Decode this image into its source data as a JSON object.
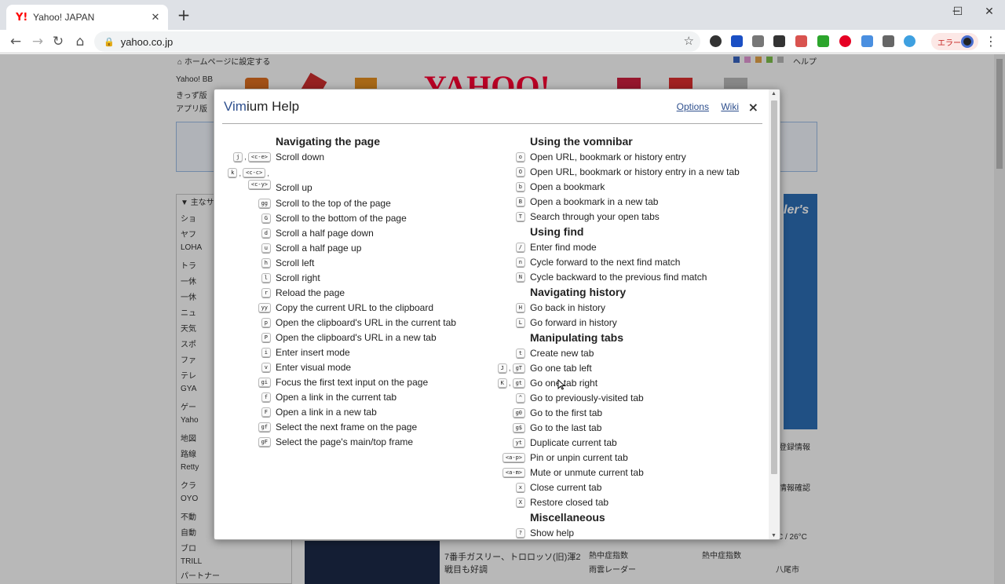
{
  "browser": {
    "tab_title": "Yahoo! JAPAN",
    "tab_favicon": "Y!",
    "new_tab": "+",
    "url": "yahoo.co.jp",
    "error_label": "エラー",
    "window": {
      "minimize": "─",
      "maximize": "☐",
      "close": "✕"
    }
  },
  "page_bg": {
    "home_link": "ホームページに設定する",
    "help": "ヘルプ",
    "left_links": [
      "Yahoo! BB",
      "きっず版",
      "アプリ版"
    ],
    "logo": "YAHOO!",
    "sidebar_header": "主なサ",
    "sidebar_items": [
      "ショ",
      "ヤフ",
      "LOHA",
      "トラ",
      "一休",
      "一休",
      "ニュ",
      "天気",
      "スポ",
      "ファ",
      "テレ",
      "GYA",
      "ゲー",
      "Yaho",
      "地図",
      "路線",
      "Retty",
      "クラ",
      "OYO",
      "不動",
      "自動",
      "ブロ",
      "TRILL",
      "パートナー"
    ],
    "ad_text": "ler's",
    "news_lines": [
      "7番手ガスリー、トロロッソ(旧)渾2",
      "戦目も好調"
    ],
    "weather": {
      "heat1": "熱中症指数",
      "heat2": "熱中症指数",
      "radar": "雨雲レーダー",
      "city": "八尾市",
      "temp": "C / 26°C",
      "login": "登録情報",
      "confirm": "情報確認"
    }
  },
  "modal": {
    "title_prefix": "Vim",
    "title_suffix": "ium Help",
    "options_link": "Options",
    "wiki_link": "Wiki",
    "close": "×",
    "left_sections": [
      {
        "title": "Navigating the page",
        "items": [
          {
            "keys": [
              "j",
              "<c-e>"
            ],
            "desc": "Scroll down"
          },
          {
            "keys": [
              "k",
              "<c-c>",
              "<c-y>"
            ],
            "desc": "Scroll up",
            "tall": true
          },
          {
            "keys": [
              "gg"
            ],
            "desc": "Scroll to the top of the page"
          },
          {
            "keys": [
              "G"
            ],
            "desc": "Scroll to the bottom of the page"
          },
          {
            "keys": [
              "d"
            ],
            "desc": "Scroll a half page down"
          },
          {
            "keys": [
              "u"
            ],
            "desc": "Scroll a half page up"
          },
          {
            "keys": [
              "h"
            ],
            "desc": "Scroll left"
          },
          {
            "keys": [
              "l"
            ],
            "desc": "Scroll right"
          },
          {
            "keys": [
              "r"
            ],
            "desc": "Reload the page"
          },
          {
            "keys": [
              "yy"
            ],
            "desc": "Copy the current URL to the clipboard"
          },
          {
            "keys": [
              "p"
            ],
            "desc": "Open the clipboard's URL in the current tab"
          },
          {
            "keys": [
              "P"
            ],
            "desc": "Open the clipboard's URL in a new tab"
          },
          {
            "keys": [
              "i"
            ],
            "desc": "Enter insert mode"
          },
          {
            "keys": [
              "v"
            ],
            "desc": "Enter visual mode"
          },
          {
            "keys": [
              "gi"
            ],
            "desc": "Focus the first text input on the page"
          },
          {
            "keys": [
              "f"
            ],
            "desc": "Open a link in the current tab"
          },
          {
            "keys": [
              "F"
            ],
            "desc": "Open a link in a new tab"
          },
          {
            "keys": [
              "gf"
            ],
            "desc": "Select the next frame on the page"
          },
          {
            "keys": [
              "gF"
            ],
            "desc": "Select the page's main/top frame"
          }
        ]
      }
    ],
    "right_sections": [
      {
        "title": "Using the vomnibar",
        "items": [
          {
            "keys": [
              "o"
            ],
            "desc": "Open URL, bookmark or history entry"
          },
          {
            "keys": [
              "O"
            ],
            "desc": "Open URL, bookmark or history entry in a new tab"
          },
          {
            "keys": [
              "b"
            ],
            "desc": "Open a bookmark"
          },
          {
            "keys": [
              "B"
            ],
            "desc": "Open a bookmark in a new tab"
          },
          {
            "keys": [
              "T"
            ],
            "desc": "Search through your open tabs"
          }
        ]
      },
      {
        "title": "Using find",
        "items": [
          {
            "keys": [
              "/"
            ],
            "desc": "Enter find mode"
          },
          {
            "keys": [
              "n"
            ],
            "desc": "Cycle forward to the next find match"
          },
          {
            "keys": [
              "N"
            ],
            "desc": "Cycle backward to the previous find match"
          }
        ]
      },
      {
        "title": "Navigating history",
        "items": [
          {
            "keys": [
              "H"
            ],
            "desc": "Go back in history"
          },
          {
            "keys": [
              "L"
            ],
            "desc": "Go forward in history"
          }
        ]
      },
      {
        "title": "Manipulating tabs",
        "items": [
          {
            "keys": [
              "t"
            ],
            "desc": "Create new tab"
          },
          {
            "keys": [
              "J",
              "gT"
            ],
            "desc": "Go one tab left"
          },
          {
            "keys": [
              "K",
              "gt"
            ],
            "desc": "Go one tab right"
          },
          {
            "keys": [
              "^"
            ],
            "desc": "Go to previously-visited tab"
          },
          {
            "keys": [
              "g0"
            ],
            "desc": "Go to the first tab"
          },
          {
            "keys": [
              "g$"
            ],
            "desc": "Go to the last tab"
          },
          {
            "keys": [
              "yt"
            ],
            "desc": "Duplicate current tab"
          },
          {
            "keys": [
              "<a-p>"
            ],
            "desc": "Pin or unpin current tab"
          },
          {
            "keys": [
              "<a-m>"
            ],
            "desc": "Mute or unmute current tab"
          },
          {
            "keys": [
              "x"
            ],
            "desc": "Close current tab"
          },
          {
            "keys": [
              "X"
            ],
            "desc": "Restore closed tab"
          }
        ]
      },
      {
        "title": "Miscellaneous",
        "items": [
          {
            "keys": [
              "?"
            ],
            "desc": "Show help"
          }
        ]
      }
    ]
  },
  "colors": {
    "accent": "#2f508e",
    "tabbar": "#dee1e6",
    "error": "#c5221f"
  }
}
